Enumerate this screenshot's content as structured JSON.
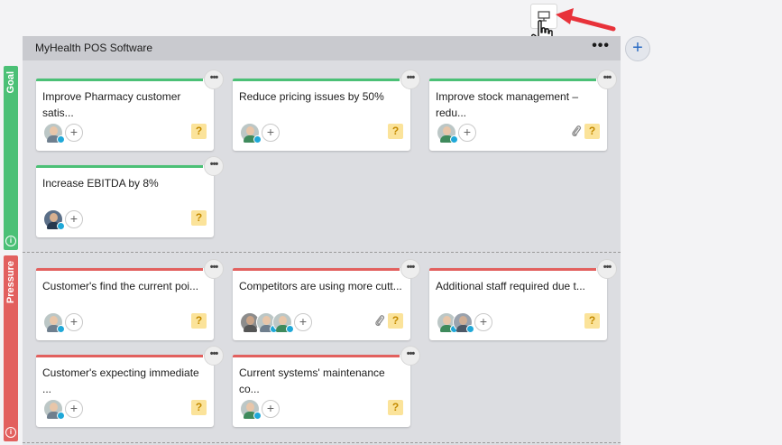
{
  "board": {
    "title": "MyHealth POS Software",
    "menu_label": "•••",
    "add_label": "+"
  },
  "lanes": [
    {
      "label": "Goal",
      "info": "i"
    },
    {
      "label": "Pressure",
      "info": "i"
    }
  ],
  "cards": [
    {
      "title": "Improve Pharmacy customer satis...",
      "question": "?",
      "more": "•••",
      "add": "+"
    },
    {
      "title": "Reduce pricing issues by 50%",
      "question": "?",
      "more": "•••",
      "add": "+"
    },
    {
      "title": "Improve stock management – redu...",
      "question": "?",
      "more": "•••",
      "add": "+"
    },
    {
      "title": "Increase EBITDA by 8%",
      "question": "?",
      "more": "•••",
      "add": "+"
    },
    {
      "title": "Customer's find the current poi...",
      "question": "?",
      "more": "•••",
      "add": "+"
    },
    {
      "title": "Competitors are using more cutt...",
      "question": "?",
      "more": "•••",
      "add": "+"
    },
    {
      "title": "Additional staff required due t...",
      "question": "?",
      "more": "•••",
      "add": "+"
    },
    {
      "title": "Customer's expecting immediate ...",
      "question": "?",
      "more": "•••",
      "add": "+"
    },
    {
      "title": "Current systems' maintenance co...",
      "question": "?",
      "more": "•••",
      "add": "+"
    }
  ],
  "icons": {
    "present": "presentation-icon",
    "cursor": "hand-pointer-icon",
    "arrow": "red-arrow-icon",
    "attachment": "paperclip-icon"
  },
  "colors": {
    "goal": "#4bc076",
    "pressure": "#e2605e",
    "accent": "#2b6cc4",
    "arrow": "#e8323a"
  }
}
